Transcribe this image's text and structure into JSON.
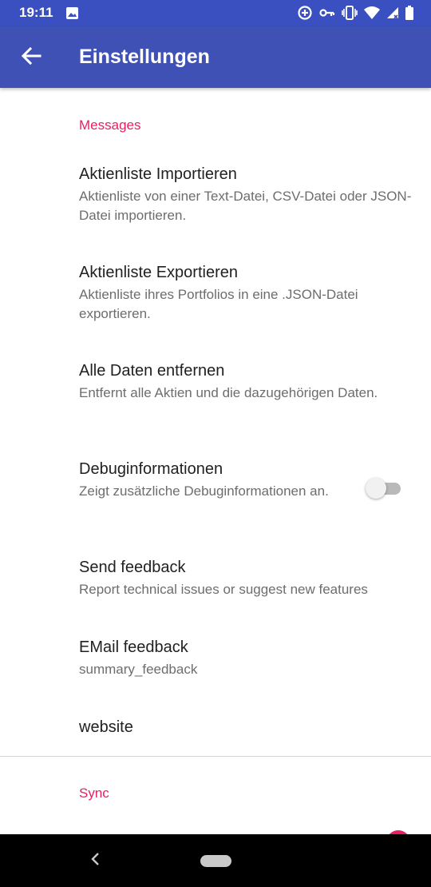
{
  "status_bar": {
    "time": "19:11",
    "icons": [
      "image-icon",
      "data-saver-icon",
      "vpn-key-icon",
      "vibrate-icon",
      "wifi-icon",
      "signal-icon",
      "battery-icon"
    ]
  },
  "app_bar": {
    "title": "Einstellungen",
    "back_icon": "arrow-back-icon"
  },
  "categories": {
    "messages": "Messages",
    "sync": "Sync"
  },
  "preferences": [
    {
      "title": "Aktienliste Importieren",
      "summary": "Aktienliste von einer Text-Datei, CSV-Datei oder JSON-Datei importieren."
    },
    {
      "title": "Aktienliste Exportieren",
      "summary": "Aktienliste ihres Portfolios in eine .JSON-Datei exportieren."
    },
    {
      "title": "Alle Daten entfernen",
      "summary": "Entfernt alle Aktien und die dazugehörigen Daten."
    },
    {
      "title": "Debuginformationen",
      "summary": "Zeigt zusätzliche Debuginformationen an.",
      "switch_on": false
    },
    {
      "title": "Send feedback",
      "summary": "Report technical issues or suggest new features"
    },
    {
      "title": "EMail feedback",
      "summary": "summary_feedback"
    },
    {
      "title": "website"
    }
  ],
  "colors": {
    "primary": "#3f51b5",
    "primary_dark": "#3a50c0",
    "accent": "#e91e63",
    "title_text": "#212121",
    "summary_text": "#6d6d6d"
  },
  "nav_bar": {
    "icons": [
      "nav-back-icon",
      "nav-home-pill"
    ]
  }
}
